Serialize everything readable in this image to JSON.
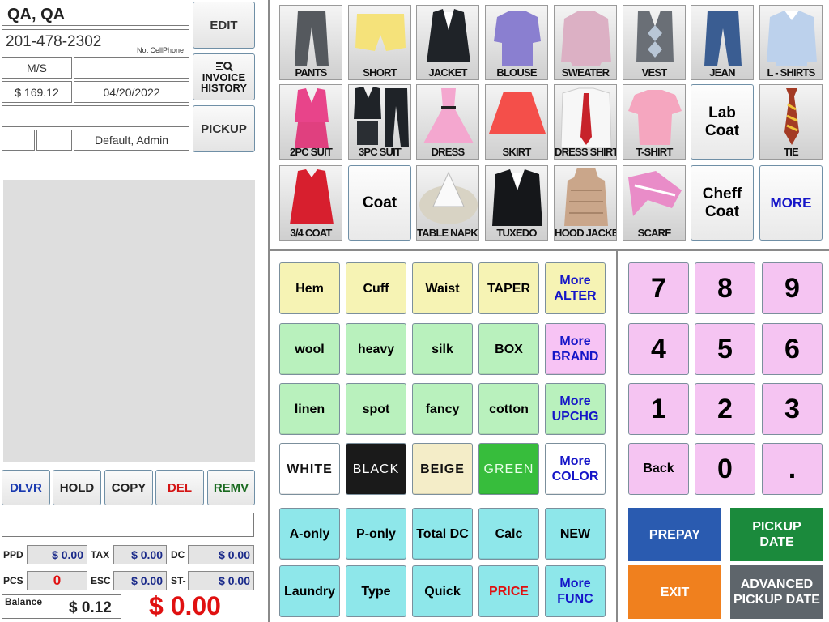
{
  "customer": {
    "name": "QA, QA",
    "phone": "201-478-2302",
    "phone_note": "Not CellPhone",
    "type": "M/S",
    "amount": "$ 169.12",
    "date": "04/20/2022",
    "user": "Default, Admin"
  },
  "side_buttons": {
    "edit": "EDIT",
    "invoice_line1": "INVOICE",
    "invoice_line2": "HISTORY",
    "pickup": "PICKUP"
  },
  "action_buttons": {
    "dlvr": "DLVR",
    "hold": "HOLD",
    "copy": "COPY",
    "del": "DEL",
    "remv": "REMV"
  },
  "totals": {
    "ppd_label": "PPD",
    "ppd": "$ 0.00",
    "tax_label": "TAX",
    "tax": "$ 0.00",
    "dc_label": "DC",
    "dc": "$ 0.00",
    "pcs_label": "PCS",
    "pcs": "0",
    "esc_label": "ESC",
    "esc": "$ 0.00",
    "st_label": "ST-",
    "st": "$ 0.00",
    "balance_label": "Balance",
    "balance": "$ 0.12",
    "total": "$ 0.00"
  },
  "garments": {
    "pants": "PANTS",
    "short": "SHORT",
    "jacket": "JACKET",
    "blouse": "BLOUSE",
    "sweater": "SWEATER",
    "vest": "VEST",
    "jean": "JEAN",
    "lshirts": "L - SHIRTS",
    "suit2": "2PC SUIT",
    "suit3": "3PC SUIT",
    "dress": "DRESS",
    "skirt": "SKIRT",
    "dress_shirts": "DRESS SHIRTS",
    "tshirt": "T-SHIRT",
    "lab_coat": "Lab Coat",
    "tie": "TIE",
    "coat34": "3/4 COAT",
    "coat": "Coat",
    "napkin": "TABLE NAPKIN",
    "tuxedo": "TUXEDO",
    "hood_jacket": "HOOD JACKET",
    "scarf": "SCARF",
    "cheff_coat": "Cheff Coat",
    "more": "MORE"
  },
  "alter": {
    "hem": "Hem",
    "cuff": "Cuff",
    "waist": "Waist",
    "taper": "TAPER",
    "more_1": "More",
    "more_2": "ALTER"
  },
  "brand": {
    "wool": "wool",
    "heavy": "heavy",
    "silk": "silk",
    "box": "BOX",
    "more_1": "More",
    "more_2": "BRAND"
  },
  "upcharge": {
    "linen": "linen",
    "spot": "spot",
    "fancy": "fancy",
    "cotton": "cotton",
    "more_1": "More",
    "more_2": "UPCHG"
  },
  "colors": {
    "white": "WHITE",
    "black": "BLACK",
    "beige": "BEIGE",
    "green": "GREEN",
    "more_1": "More",
    "more_2": "COLOR"
  },
  "funcs": {
    "a_only": "A-only",
    "p_only": "P-only",
    "total_dc": "Total DC",
    "calc": "Calc",
    "new": "NEW",
    "laundry": "Laundry",
    "type": "Type",
    "quick": "Quick",
    "price": "PRICE",
    "more_1": "More",
    "more_2": "FUNC"
  },
  "keypad": {
    "k7": "7",
    "k8": "8",
    "k9": "9",
    "k4": "4",
    "k5": "5",
    "k6": "6",
    "k1": "1",
    "k2": "2",
    "k3": "3",
    "back": "Back",
    "k0": "0",
    "dot": "."
  },
  "bottom_actions": {
    "prepay": "PREPAY",
    "pickup_date_1": "PICKUP",
    "pickup_date_2": "DATE",
    "exit": "EXIT",
    "adv_1": "ADVANCED",
    "adv_2": "PICKUP DATE"
  },
  "colors_hex": {
    "prepay": "#2a5bb0",
    "pickup_date": "#1b8a3c",
    "exit": "#f0801e",
    "advanced": "#5e656b",
    "total_red": "#e01010"
  }
}
